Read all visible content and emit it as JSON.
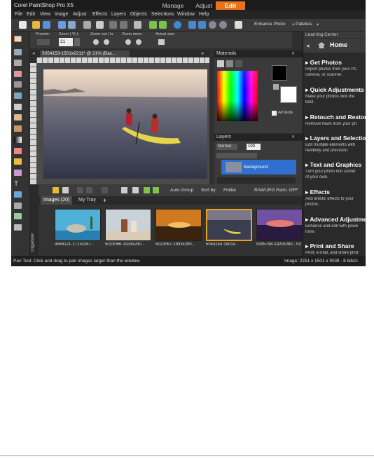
{
  "app": {
    "title": "Corel PaintShop Pro X5"
  },
  "tabs": [
    {
      "label": "Manage"
    },
    {
      "label": "Adjust"
    },
    {
      "label": "Edit"
    }
  ],
  "menu": [
    "File",
    "Edit",
    "View",
    "Image",
    "Adjust",
    "Effects",
    "Layers",
    "Objects",
    "Selections",
    "Window",
    "Help"
  ],
  "toolbar": {
    "enhance_label": "Enhance Photo",
    "palettes_label": "Palettes"
  },
  "options": {
    "presets_label": "Presets:",
    "zoom_label": "Zoom ( % ):",
    "zoom_value": "21",
    "zoomout_label": "Zoom out / in:",
    "zoommore_label": "Zoom more:",
    "actualsize_label": "Actual size:"
  },
  "document": {
    "tab_label": "5054153-1501x2211* @ 21% (Bac..."
  },
  "materials": {
    "title": "Materials",
    "all_tools_label": "All tools"
  },
  "layers": {
    "title": "Layers",
    "blend_mode": "Normal",
    "opacity": "100",
    "layer_name": "Background"
  },
  "organizer": {
    "side_label": "Organizer",
    "auto_group": "Auto Group",
    "sort_by": "Sort by:",
    "sort_value": "Folder",
    "raw_label": "RAW/JPG Pairs: OFF",
    "tab_images": "Images (20)",
    "tab_tray": "My Tray",
    "tab_add": "+",
    "thumbs": [
      {
        "caption": "4569121-1713x257..."
      },
      {
        "caption": "5023066-1933x290..."
      },
      {
        "caption": "5023067-1933x290..."
      },
      {
        "caption": "5054153-1501x..."
      },
      {
        "caption": "5095798-1920x280..."
      },
      {
        "caption": "53"
      }
    ]
  },
  "learning": {
    "header": "Learning Center",
    "home": "Home",
    "sections": [
      {
        "title": "Get Photos",
        "desc": [
          "Import photos from your PC",
          "camera, or scanner."
        ]
      },
      {
        "title": "Quick Adjustments",
        "desc": [
          "Make your photos look the",
          "best."
        ]
      },
      {
        "title": "Retouch and Restore",
        "desc": [
          "Remove flaws from your ph"
        ]
      },
      {
        "title": "Layers and Selections",
        "desc": [
          "Edit multiple elements with",
          "flexibility and precision."
        ]
      },
      {
        "title": "Text and Graphics",
        "desc": [
          "Turn your photo into somet",
          "of your own."
        ]
      },
      {
        "title": "Effects",
        "desc": [
          "Add artistic effects to your",
          "photos."
        ]
      },
      {
        "title": "Advanced Adjustments",
        "desc": [
          "Enhance and edit with powe",
          "tools."
        ]
      },
      {
        "title": "Print and Share",
        "desc": [
          "Print, e-mail, and share phot"
        ]
      }
    ]
  },
  "status": {
    "left": "Pan Tool: Click and drag to pan images larger than the window.",
    "right": "Image:  2251 x 1501 x RGB - 8 bits/c"
  },
  "colors": {
    "accent": "#e9731c",
    "panel_bg": "#2f2f2f",
    "layer_selected": "#2e6fd0"
  }
}
